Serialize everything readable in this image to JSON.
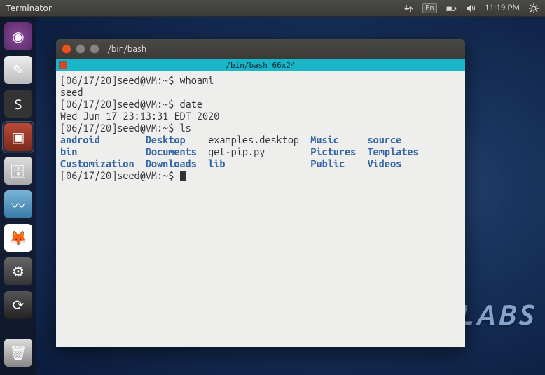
{
  "menubar": {
    "title": "Terminator",
    "lang": "En",
    "time": "11:19 PM"
  },
  "launcher": {
    "items": [
      {
        "name": "ubuntu-dash",
        "glyph": "◉"
      },
      {
        "name": "text-editor",
        "glyph": "✎"
      },
      {
        "name": "sublime-text",
        "glyph": "S"
      },
      {
        "name": "terminator",
        "glyph": "▣",
        "active": true
      },
      {
        "name": "files",
        "glyph": "🗄"
      },
      {
        "name": "wireshark",
        "glyph": "〰"
      },
      {
        "name": "firefox",
        "glyph": "🦊"
      },
      {
        "name": "system-settings",
        "glyph": "⚙"
      },
      {
        "name": "software-updater",
        "glyph": "⟳"
      }
    ],
    "trash": {
      "name": "trash",
      "glyph": "🗑"
    }
  },
  "window": {
    "title": "/bin/bash",
    "tab_label": "/bin/bash 66x24"
  },
  "terminal": {
    "lines": [
      {
        "type": "cmd",
        "prompt": "[06/17/20]seed@VM:~$ ",
        "text": "whoami"
      },
      {
        "type": "out",
        "text": "seed"
      },
      {
        "type": "cmd",
        "prompt": "[06/17/20]seed@VM:~$ ",
        "text": "date"
      },
      {
        "type": "out",
        "text": "Wed Jun 17 23:13:31 EDT 2020"
      },
      {
        "type": "cmd",
        "prompt": "[06/17/20]seed@VM:~$ ",
        "text": "ls"
      }
    ],
    "ls_cols": [
      [
        "android",
        "bin",
        "Customization"
      ],
      [
        "Desktop",
        "Documents",
        "Downloads"
      ],
      [
        "examples.desktop",
        "get-pip.py",
        "lib"
      ],
      [
        "Music",
        "Pictures",
        "Public"
      ],
      [
        "source",
        "Templates",
        "Videos"
      ]
    ],
    "ls_plain": {
      "0_2": true,
      "1_2": true
    },
    "final_prompt": "[06/17/20]seed@VM:~$ "
  },
  "watermark": "DLABS"
}
